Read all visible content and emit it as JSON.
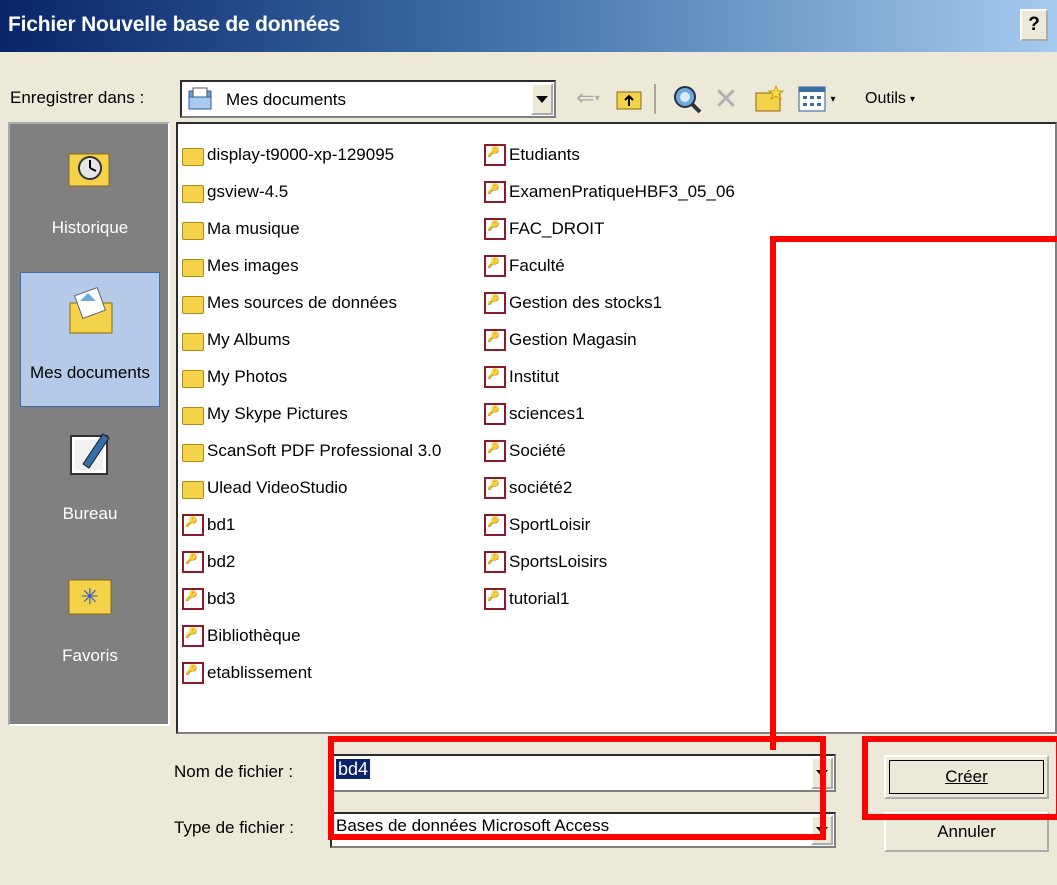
{
  "window": {
    "title": "Fichier Nouvelle base de données",
    "help": "?"
  },
  "toolbar": {
    "save_in_label": "Enregistrer dans :",
    "save_in_value": "Mes documents",
    "tools_label": "Outils"
  },
  "places": [
    {
      "label": "Historique",
      "icon": "history-icon"
    },
    {
      "label": "Mes documents",
      "icon": "my-documents-icon",
      "selected": true
    },
    {
      "label": "Bureau",
      "icon": "desktop-icon"
    },
    {
      "label": "Favoris",
      "icon": "favorites-icon"
    }
  ],
  "files": {
    "column1": [
      {
        "name": "display-t9000-xp-129095",
        "type": "folder"
      },
      {
        "name": "gsview-4.5",
        "type": "folder"
      },
      {
        "name": "Ma musique",
        "type": "folder"
      },
      {
        "name": "Mes images",
        "type": "folder"
      },
      {
        "name": "Mes sources de données",
        "type": "folder"
      },
      {
        "name": "My Albums",
        "type": "folder"
      },
      {
        "name": "My Photos",
        "type": "folder"
      },
      {
        "name": "My Skype Pictures",
        "type": "folder"
      },
      {
        "name": "ScanSoft PDF Professional 3.0",
        "type": "folder"
      },
      {
        "name": "Ulead VideoStudio",
        "type": "folder"
      },
      {
        "name": "bd1",
        "type": "access"
      },
      {
        "name": "bd2",
        "type": "access"
      },
      {
        "name": "bd3",
        "type": "access"
      },
      {
        "name": "Bibliothèque",
        "type": "access"
      },
      {
        "name": "etablissement",
        "type": "access"
      }
    ],
    "column2": [
      {
        "name": "Etudiants",
        "type": "access"
      },
      {
        "name": "ExamenPratiqueHBF3_05_06",
        "type": "access"
      },
      {
        "name": "FAC_DROIT",
        "type": "access"
      },
      {
        "name": "Faculté",
        "type": "access"
      },
      {
        "name": "Gestion des stocks1",
        "type": "access"
      },
      {
        "name": "Gestion Magasin",
        "type": "access"
      },
      {
        "name": "Institut",
        "type": "access"
      },
      {
        "name": "sciences1",
        "type": "access"
      },
      {
        "name": "Société",
        "type": "access"
      },
      {
        "name": "société2",
        "type": "access"
      },
      {
        "name": "SportLoisir",
        "type": "access"
      },
      {
        "name": "SportsLoisirs",
        "type": "access"
      },
      {
        "name": "tutorial1",
        "type": "access"
      }
    ]
  },
  "form": {
    "filename_label": "Nom de fichier :",
    "filename_value": "bd4",
    "filetype_label": "Type de fichier :",
    "filetype_value": "Bases de données Microsoft Access"
  },
  "buttons": {
    "create": "Créer",
    "cancel": "Annuler"
  },
  "colors": {
    "highlight": "#ff0000",
    "title_bar": "#0a246a",
    "face": "#ece9d8"
  }
}
